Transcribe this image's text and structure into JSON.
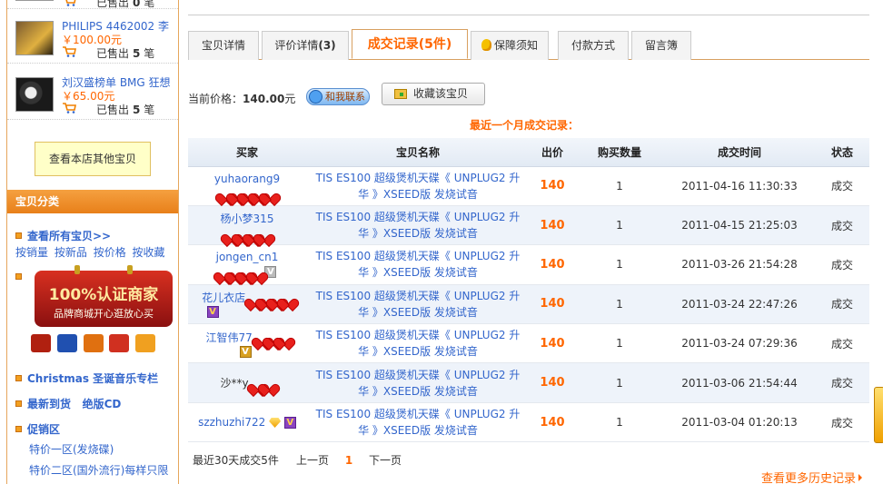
{
  "sidebar": {
    "products": [
      {
        "name": "",
        "price": "",
        "sold_label": "已售出",
        "sold_count": "0",
        "unit": "笔"
      },
      {
        "name": "PHILIPS 4462002 李",
        "price": "￥100.00元",
        "sold_label": "已售出",
        "sold_count": "5",
        "unit": "笔"
      },
      {
        "name": "刘汉盛榜单 BMG 狂想",
        "price": "￥65.00元",
        "sold_label": "已售出",
        "sold_count": "5",
        "unit": "笔"
      }
    ],
    "view_other_label": "查看本店其他宝贝",
    "category_header": "宝贝分类",
    "view_all_label": "查看所有宝贝>>",
    "sort_links": [
      "按销量",
      "按新品",
      "按价格",
      "按收藏"
    ],
    "badge": {
      "title": "100%认证商家",
      "subtitle": "品牌商城开心逛放心买"
    },
    "categories": [
      {
        "label": "Christmas 圣诞音乐专栏"
      },
      {
        "label": "最新到货",
        "label2": "绝版CD"
      },
      {
        "label": "促销区"
      }
    ],
    "subcategories": [
      "特价一区(发烧碟)",
      "特价二区(国外流行)每样只限"
    ]
  },
  "tabs": [
    {
      "label": "宝贝详情"
    },
    {
      "label": "评价详情",
      "count": "(3)"
    },
    {
      "label": "成交记录",
      "count": "(5件)"
    },
    {
      "label": "保障须知"
    },
    {
      "label": "付款方式"
    },
    {
      "label": "留言簿"
    }
  ],
  "price_bar": {
    "label": "当前价格：",
    "value": "140.00",
    "unit": "元",
    "contact_label": "和我联系",
    "favorite_label": "收藏该宝贝"
  },
  "recent_title": "最近一个月成交记录：",
  "table": {
    "headers": [
      "买家",
      "宝贝名称",
      "出价",
      "购买数量",
      "成交时间",
      "状态"
    ],
    "rows": [
      {
        "buyer": "yuhaorang9",
        "item": "TIS ES100 超级煲机天碟《 UNPLUG2 升华 》XSEED版 发烧试音",
        "price": "140",
        "qty": "1",
        "time": "2011-04-16 11:30:33",
        "status": "成交"
      },
      {
        "buyer": "杨小梦315",
        "item": "TIS ES100 超级煲机天碟《 UNPLUG2 升华 》XSEED版 发烧试音",
        "price": "140",
        "qty": "1",
        "time": "2011-04-15 21:25:03",
        "status": "成交"
      },
      {
        "buyer": "jongen_cn1",
        "item": "TIS ES100 超级煲机天碟《 UNPLUG2 升华 》XSEED版 发烧试音",
        "price": "140",
        "qty": "1",
        "time": "2011-03-26 21:54:28",
        "status": "成交"
      },
      {
        "buyer": "花儿衣店",
        "item": "TIS ES100 超级煲机天碟《 UNPLUG2 升华 》XSEED版 发烧试音",
        "price": "140",
        "qty": "1",
        "time": "2011-03-24 22:47:26",
        "status": "成交"
      },
      {
        "buyer": "江智伟77",
        "item": "TIS ES100 超级煲机天碟《 UNPLUG2 升华 》XSEED版 发烧试音",
        "price": "140",
        "qty": "1",
        "time": "2011-03-24 07:29:36",
        "status": "成交"
      },
      {
        "buyer": "沙**y",
        "item": "TIS ES100 超级煲机天碟《 UNPLUG2 升华 》XSEED版 发烧试音",
        "price": "140",
        "qty": "1",
        "time": "2011-03-06 21:54:44",
        "status": "成交"
      },
      {
        "buyer": "szzhuzhi722",
        "item": "TIS ES100 超级煲机天碟《 UNPLUG2 升华 》XSEED版 发烧试音",
        "price": "140",
        "qty": "1",
        "time": "2011-03-04 01:20:13",
        "status": "成交"
      }
    ]
  },
  "footer": {
    "summary": "最近30天成交5件",
    "prev": "上一页",
    "page": "1",
    "next": "下一页"
  },
  "more_history": "查看更多历史记录"
}
